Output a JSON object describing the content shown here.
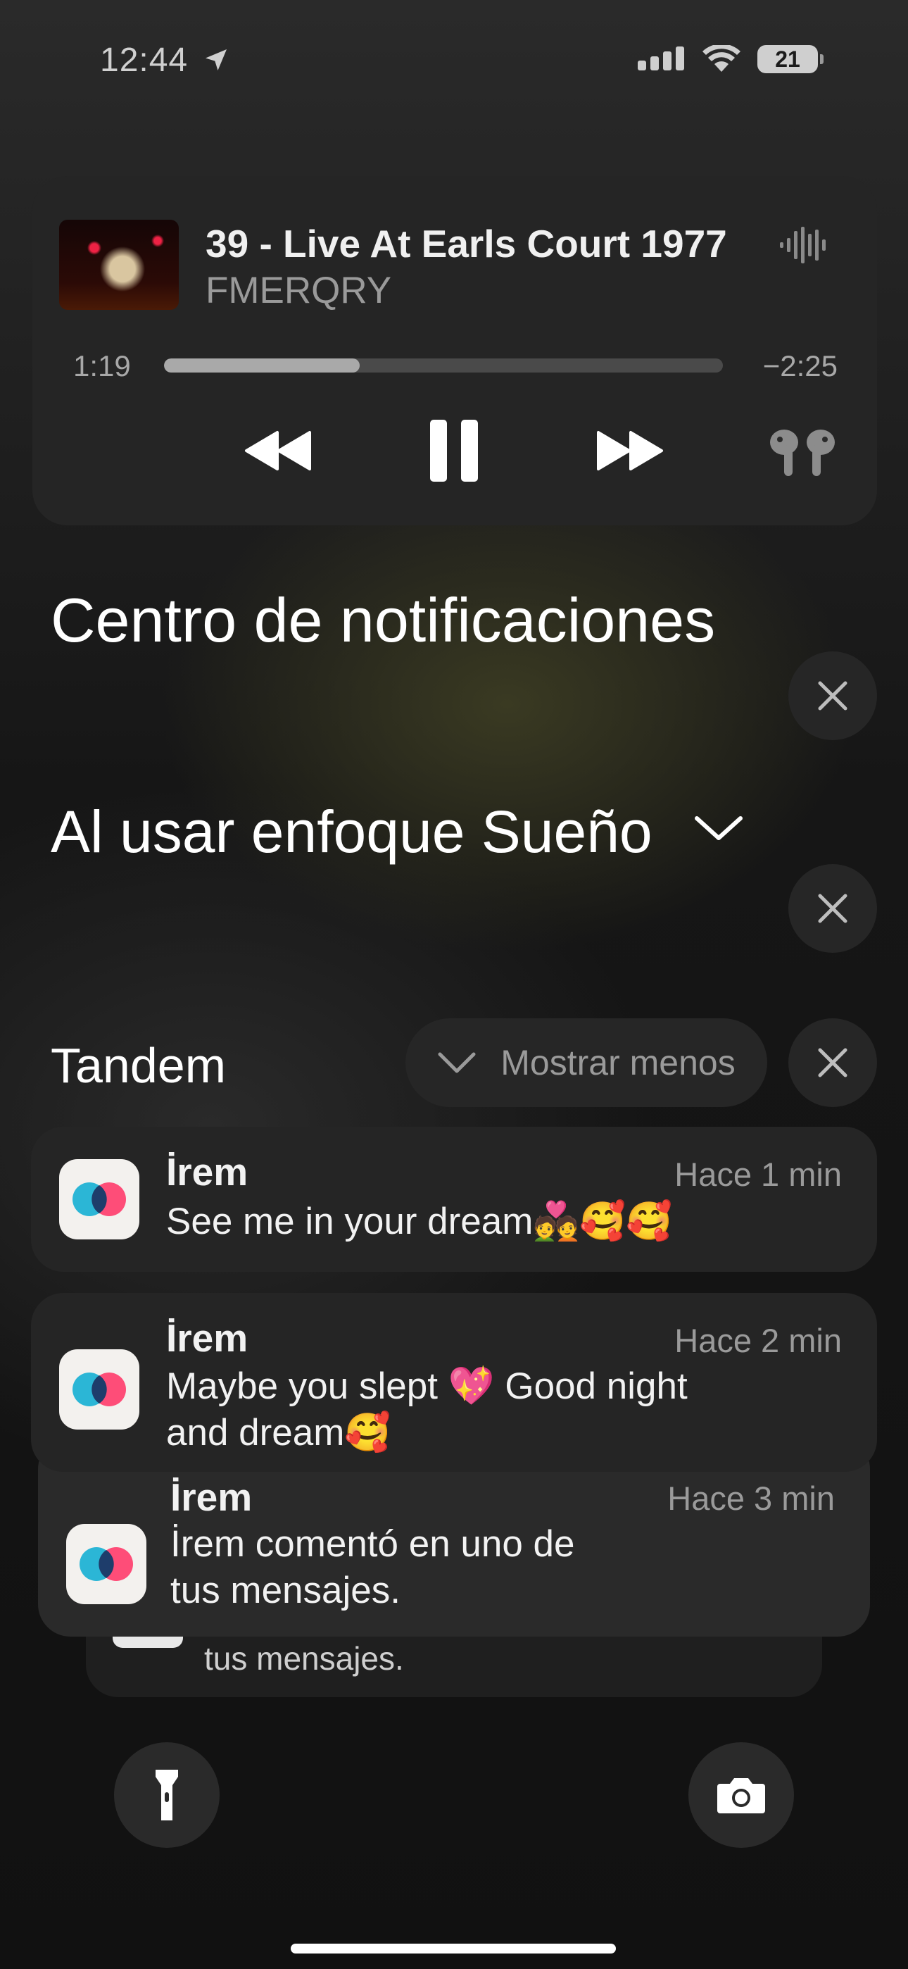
{
  "status_bar": {
    "time": "12:44",
    "battery": "21"
  },
  "now_playing": {
    "title": "39 - Live At Earls Court 1977",
    "artist": "FMERQRY",
    "elapsed": "1:19",
    "remaining": "−2:25",
    "progress": 0.35
  },
  "notification_center": {
    "title": "Centro de notificaciones",
    "focus_heading": "Al usar enfoque Sueño"
  },
  "tandem_group": {
    "app_name": "Tandem",
    "show_less_label": "Mostrar menos",
    "notifications": [
      {
        "sender": "İrem",
        "time": "Hace 1 min",
        "message": "See me in your dream💑🥰🥰"
      },
      {
        "sender": "İrem",
        "time": "Hace 2 min",
        "message_line1": "Maybe you slept 💖 Good night",
        "message_line2": "and dream🥰"
      },
      {
        "sender": "İrem",
        "time": "Hace 3 min",
        "message_line1": "İrem comentó en uno de",
        "message_line2": "tus mensajes."
      }
    ],
    "stacked_peek_text": "tus mensajes."
  },
  "colors": {
    "accent_blue": "#2bb6d6",
    "accent_pink": "#ff3f6e"
  }
}
